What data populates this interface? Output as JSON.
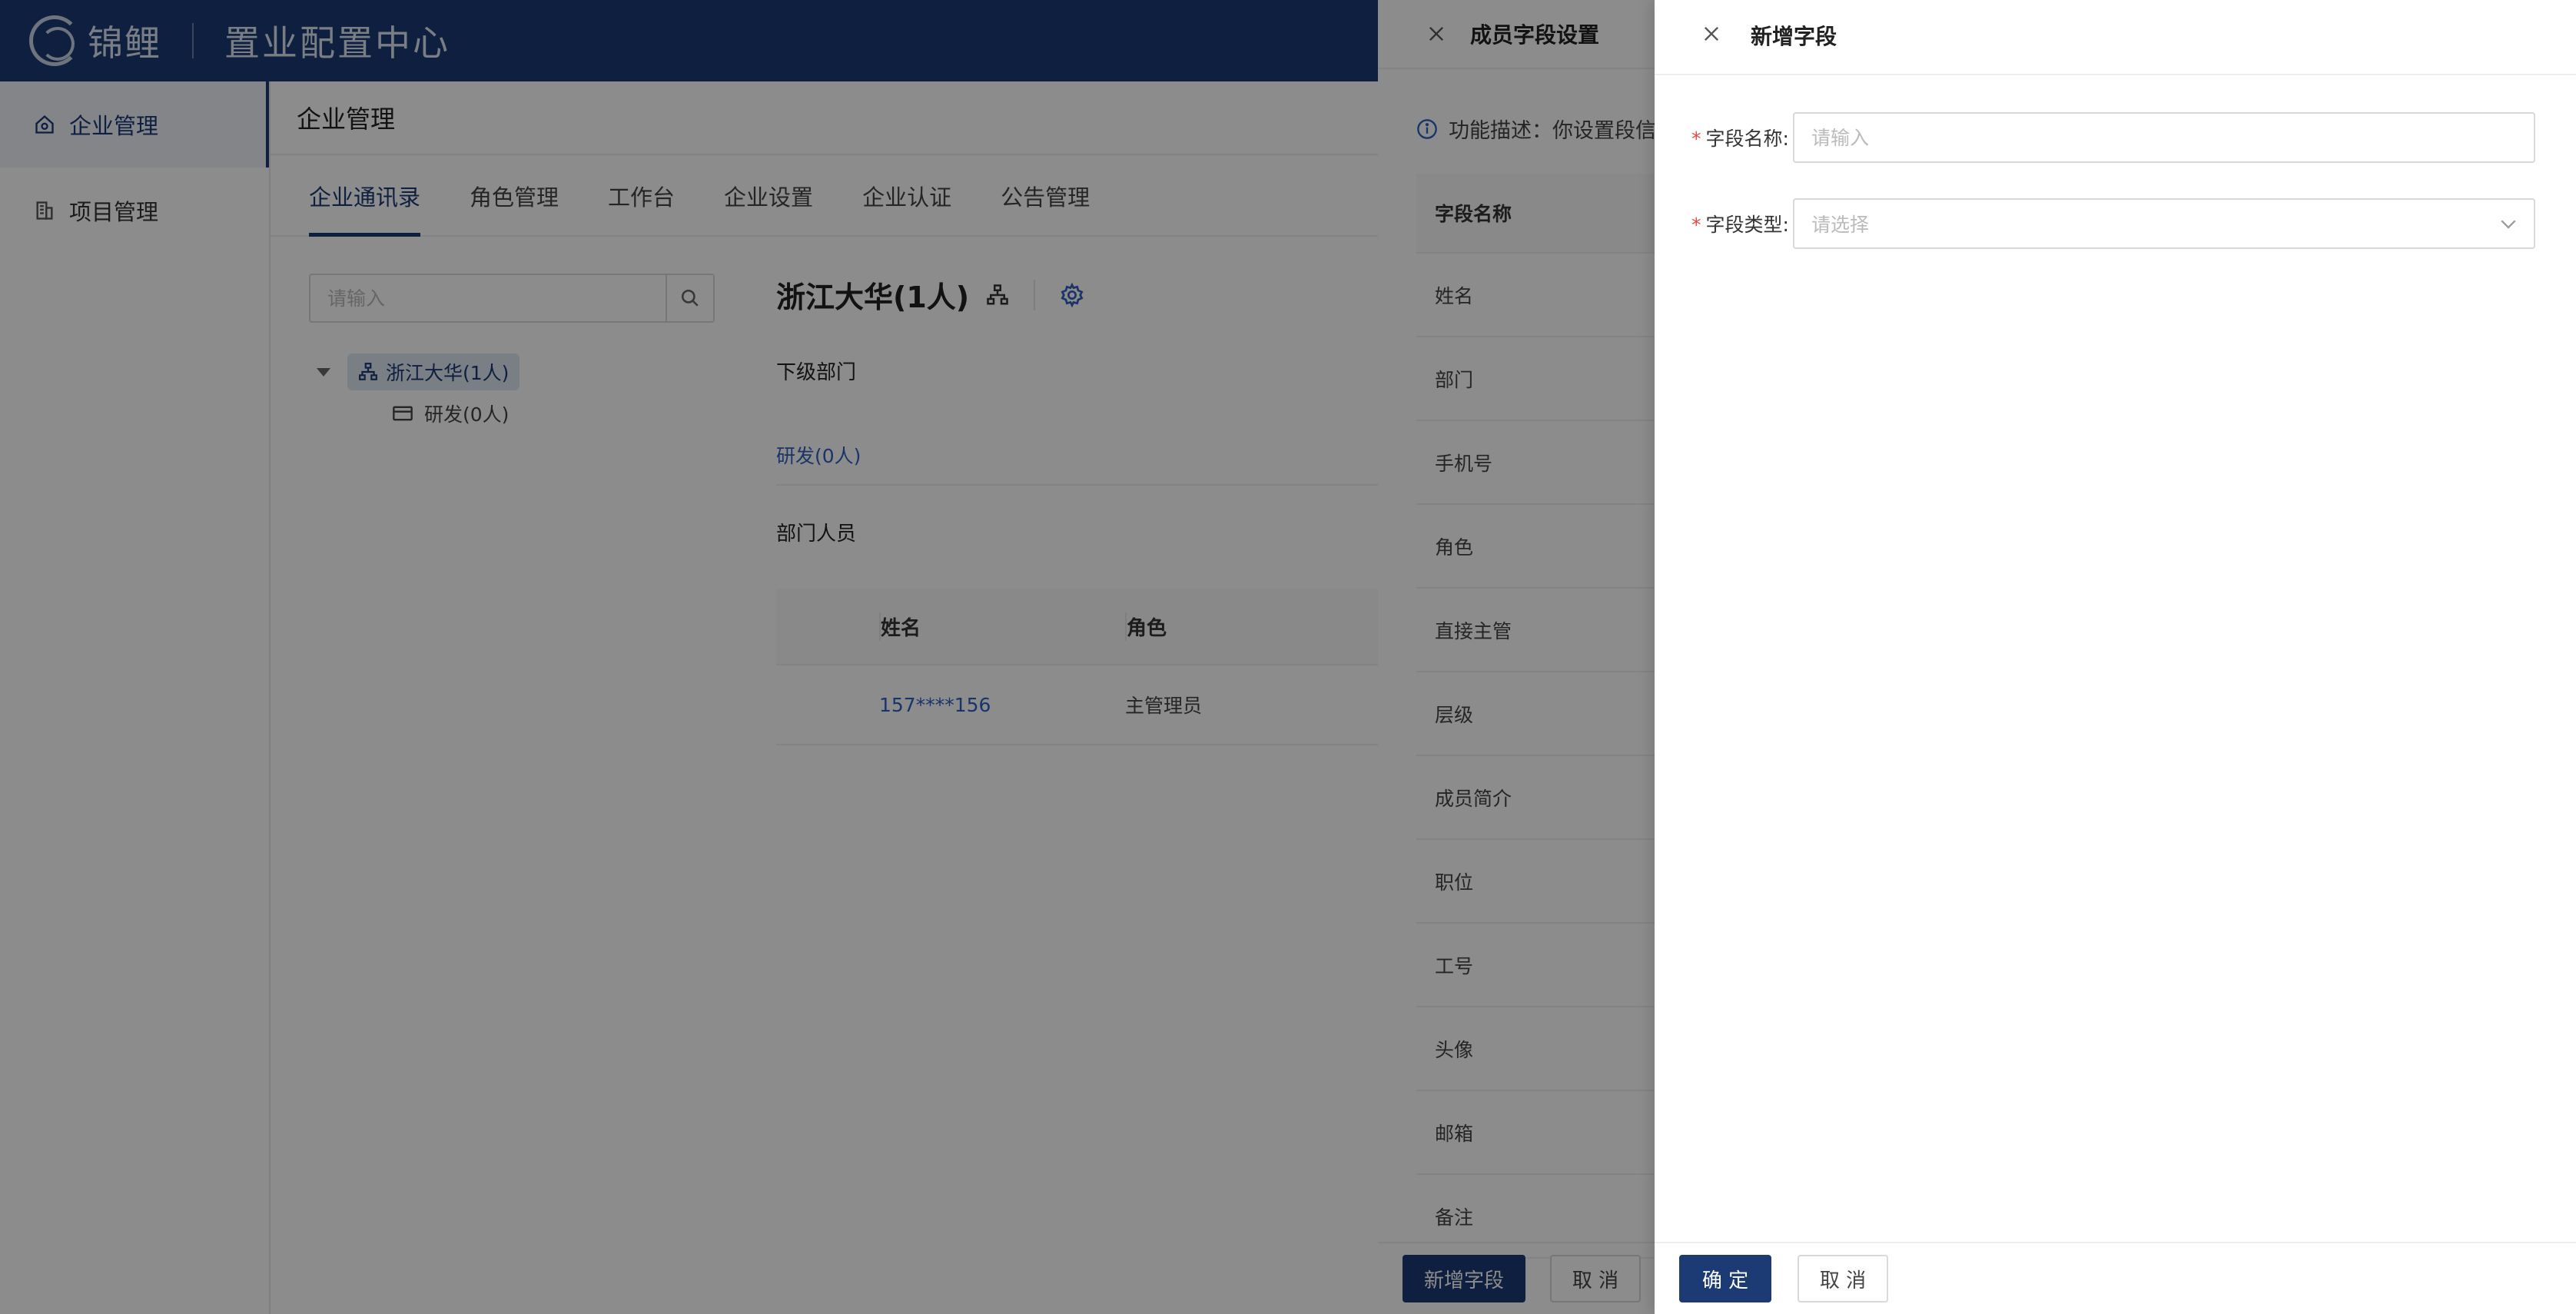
{
  "header": {
    "logo_text": "锦鲤",
    "title": "置业配置中心"
  },
  "sidebar": {
    "items": [
      {
        "label": "企业管理",
        "icon": "home-icon"
      },
      {
        "label": "项目管理",
        "icon": "building-icon"
      }
    ]
  },
  "main": {
    "title": "企业管理",
    "tabs": [
      "企业通讯录",
      "角色管理",
      "工作台",
      "企业设置",
      "企业认证",
      "公告管理"
    ],
    "search": {
      "placeholder": "请输入"
    },
    "tree": {
      "root": "浙江大华(1人)",
      "child": "研发(0人)"
    },
    "dept_title": "浙江大华(1人)",
    "sub_dept_label": "下级部门",
    "sub_dept_link": "研发(0人)",
    "members_label": "部门人员",
    "members_table": {
      "columns": [
        "姓名",
        "角色"
      ],
      "rows": [
        {
          "name": "157****156",
          "role": "主管理员"
        }
      ]
    }
  },
  "member_fields_drawer": {
    "title": "成员字段设置",
    "description": "功能描述：你设置段信",
    "table_header": "字段名称",
    "fields": [
      "姓名",
      "部门",
      "手机号",
      "角色",
      "直接主管",
      "层级",
      "成员简介",
      "职位",
      "工号",
      "头像",
      "邮箱",
      "备注"
    ],
    "add_button": "新增字段",
    "cancel_button": "取 消"
  },
  "add_field_drawer": {
    "title": "新增字段",
    "name_label": "字段名称:",
    "name_placeholder": "请输入",
    "type_label": "字段类型:",
    "type_placeholder": "请选择",
    "confirm_button": "确 定",
    "cancel_button": "取 消"
  },
  "colors": {
    "brand": "#1c3a73",
    "link": "#2f5fc0",
    "required": "#e5484d"
  }
}
